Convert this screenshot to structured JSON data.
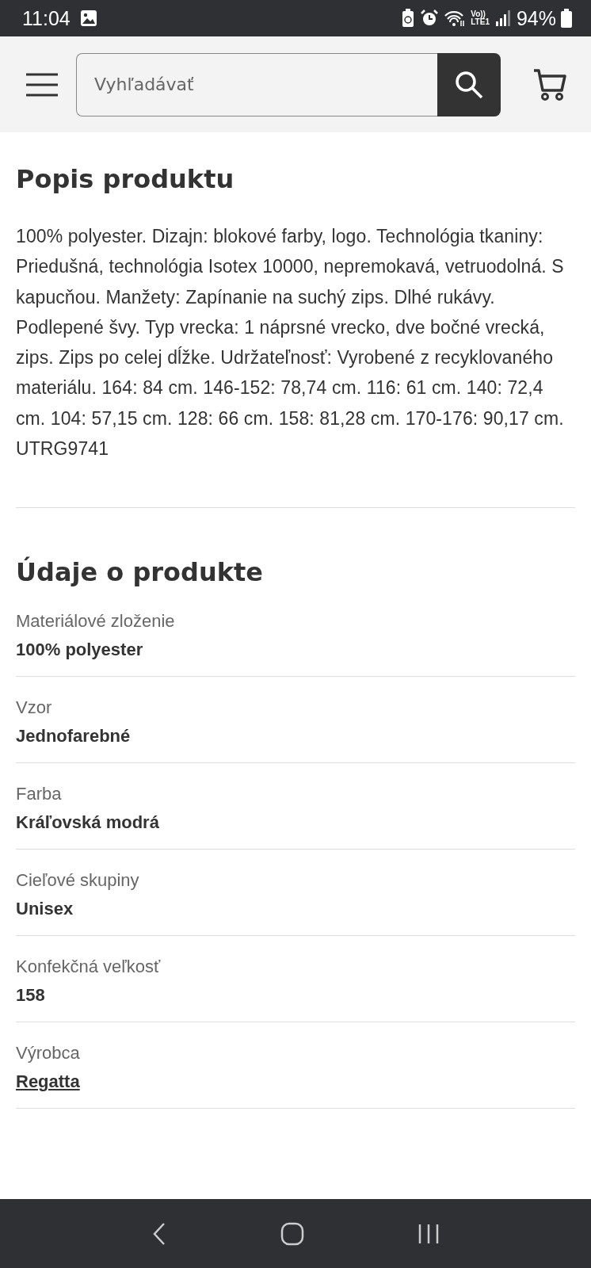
{
  "status_bar": {
    "time": "11:04",
    "network_label": "Vo))",
    "network_type": "LTE1",
    "battery": "94%"
  },
  "header": {
    "search": {
      "placeholder": "Vyhľadávať"
    }
  },
  "description": {
    "title": "Popis produktu",
    "text": "100% polyester. Dizajn: blokové farby, logo. Technológia tkaniny: Priedušná, technológia Isotex 10000, nepremokavá, vetruodolná. S kapucňou. Manžety: Zapínanie na suchý zips. Dlhé rukávy. Podlepené švy. Typ vrecka: 1 náprsné vrecko, dve bočné vrecká, zips. Zips po celej dĺžke. Udržateľnosť: Vyrobené z recyklovaného materiálu. 164: 84 cm. 146-152: 78,74 cm. 116: 61 cm. 140: 72,4 cm. 104: 57,15 cm. 128: 66 cm. 158: 81,28 cm. 170-176: 90,17 cm. UTRG9741"
  },
  "details": {
    "title": "Údaje o produkte",
    "rows": [
      {
        "label": "Materiálové zloženie",
        "value": "100% polyester",
        "kind": "text"
      },
      {
        "label": "Vzor",
        "value": "Jednofarebné",
        "kind": "text"
      },
      {
        "label": "Farba",
        "value": "Kráľovská modrá",
        "kind": "text"
      },
      {
        "label": "Cieľové skupiny",
        "value": "Unisex",
        "kind": "text"
      },
      {
        "label": "Konfekčná veľkosť",
        "value": "158",
        "kind": "text"
      },
      {
        "label": "Výrobca",
        "value": "Regatta",
        "kind": "link"
      }
    ]
  }
}
